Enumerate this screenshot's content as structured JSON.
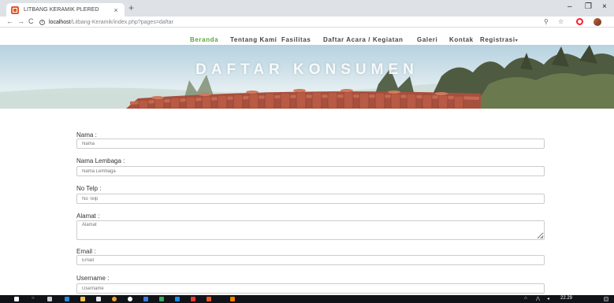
{
  "browser": {
    "tab_title": "LITBANG KERAMIK PLERED",
    "tab_close": "×",
    "new_tab": "+",
    "minimize": "–",
    "maximize": "❐",
    "close": "×",
    "back": "←",
    "forward": "→",
    "reload": "C",
    "info": "i",
    "url_host": "localhost",
    "url_path": "/Litbang-Keramik/index.php?pages=daftar",
    "zoom_glyph": "⚲",
    "star_glyph": "☆"
  },
  "nav": {
    "items": [
      {
        "label": "Beranda",
        "active": true
      },
      {
        "label": "Tentang Kami"
      },
      {
        "label": "Fasilitas"
      },
      {
        "label": "Daftar Acara / Kegiatan"
      },
      {
        "label": "Galeri"
      },
      {
        "label": "Kontak"
      },
      {
        "label": "Registrasi",
        "caret": "▾"
      }
    ],
    "active_color": "#5aa63d"
  },
  "hero": {
    "title": "DAFTAR KONSUMEN"
  },
  "form": {
    "fields": [
      {
        "label": "Nama :",
        "placeholder": "Nama"
      },
      {
        "label": "Nama Lembaga :",
        "placeholder": "Nama Lembaga"
      },
      {
        "label": "No Telp :",
        "placeholder": "No Telp"
      },
      {
        "label": "Alamat :",
        "placeholder": "Alamat",
        "multiline": true
      },
      {
        "label": "Email :",
        "placeholder": "Email"
      },
      {
        "label": "Username :",
        "placeholder": "Username"
      }
    ]
  },
  "taskbar": {
    "clock": "22.29",
    "start_icon": "windows-logo-icon",
    "search_glyph": "○"
  },
  "colors": {
    "tabbar": "#dee1e6",
    "taskbar": "#101418",
    "roof_tile": "#b85a44"
  }
}
